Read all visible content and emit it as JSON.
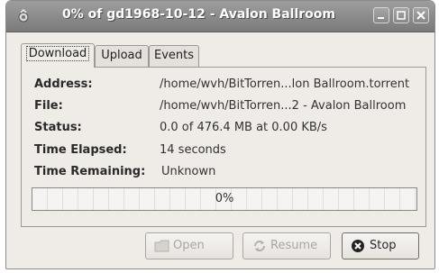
{
  "window": {
    "title": "0% of gd1968-10-12 - Avalon Ballroom",
    "controls": [
      "minimize-icon",
      "maximize-icon",
      "close-icon"
    ]
  },
  "tabs": [
    {
      "label": "Download",
      "active": true
    },
    {
      "label": "Upload",
      "active": false
    },
    {
      "label": "Events",
      "active": false
    }
  ],
  "details": {
    "address_label": "Address:",
    "address_value": "/home/wvh/BitTorren...lon Ballroom.torrent",
    "file_label": "File:",
    "file_value": "/home/wvh/BitTorren...2 - Avalon Ballroom",
    "status_label": "Status:",
    "status_value": "0.0 of 476.4 MB at 0.00 KB/s",
    "elapsed_label": "Time Elapsed:",
    "elapsed_value": "14 seconds",
    "remaining_label": "Time Remaining:",
    "remaining_value": "Unknown"
  },
  "progress": {
    "text": "0%",
    "fraction": 0.0
  },
  "buttons": {
    "open": {
      "label": "Open",
      "enabled": false,
      "icon": "folder-icon"
    },
    "resume": {
      "label": "Resume",
      "enabled": false,
      "icon": "resume-icon"
    },
    "stop": {
      "label": "Stop",
      "enabled": true,
      "icon": "stop-icon"
    }
  },
  "colors": {
    "titlebar": "#8a8a8a",
    "progress_fill": "#7d9dc4"
  }
}
